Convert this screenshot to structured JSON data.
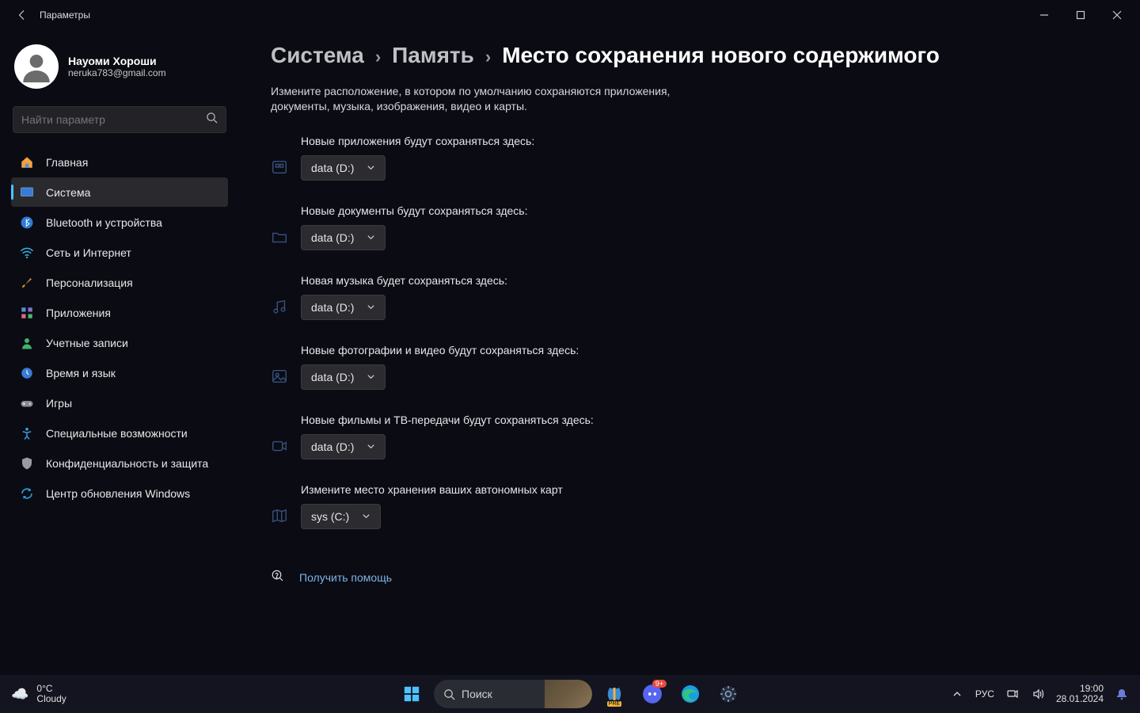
{
  "window": {
    "title": "Параметры"
  },
  "user": {
    "name": "Науоми Хороши",
    "email": "neruka783@gmail.com"
  },
  "search": {
    "placeholder": "Найти параметр"
  },
  "sidebar": {
    "items": [
      {
        "label": "Главная"
      },
      {
        "label": "Система"
      },
      {
        "label": "Bluetooth и устройства"
      },
      {
        "label": "Сеть и Интернет"
      },
      {
        "label": "Персонализация"
      },
      {
        "label": "Приложения"
      },
      {
        "label": "Учетные записи"
      },
      {
        "label": "Время и язык"
      },
      {
        "label": "Игры"
      },
      {
        "label": "Специальные возможности"
      },
      {
        "label": "Конфиденциальность и защита"
      },
      {
        "label": "Центр обновления Windows"
      }
    ]
  },
  "breadcrumb": {
    "parts": [
      "Система",
      "Память",
      "Место сохранения нового содержимого"
    ]
  },
  "description": "Измените расположение, в котором по умолчанию сохраняются приложения, документы, музыка, изображения, видео и карты.",
  "drives": {
    "data": "data (D:)",
    "sys": "sys (C:)"
  },
  "settings": [
    {
      "label": "Новые приложения будут сохраняться здесь:",
      "value": "data (D:)",
      "icon": "app"
    },
    {
      "label": "Новые документы будут сохраняться здесь:",
      "value": "data (D:)",
      "icon": "doc"
    },
    {
      "label": "Новая музыка будет сохраняться здесь:",
      "value": "data (D:)",
      "icon": "music"
    },
    {
      "label": "Новые фотографии и видео будут сохраняться здесь:",
      "value": "data (D:)",
      "icon": "photo"
    },
    {
      "label": "Новые фильмы и ТВ-передачи будут сохраняться здесь:",
      "value": "data (D:)",
      "icon": "video"
    },
    {
      "label": "Измените место хранения ваших автономных карт",
      "value": "sys (C:)",
      "icon": "map"
    }
  ],
  "help": {
    "label": "Получить помощь"
  },
  "taskbar": {
    "weather": {
      "temp": "0°C",
      "cond": "Cloudy"
    },
    "search": "Поиск",
    "lang": "РУС",
    "time": "19:00",
    "date": "28.01.2024",
    "discord_badge": "9+"
  }
}
